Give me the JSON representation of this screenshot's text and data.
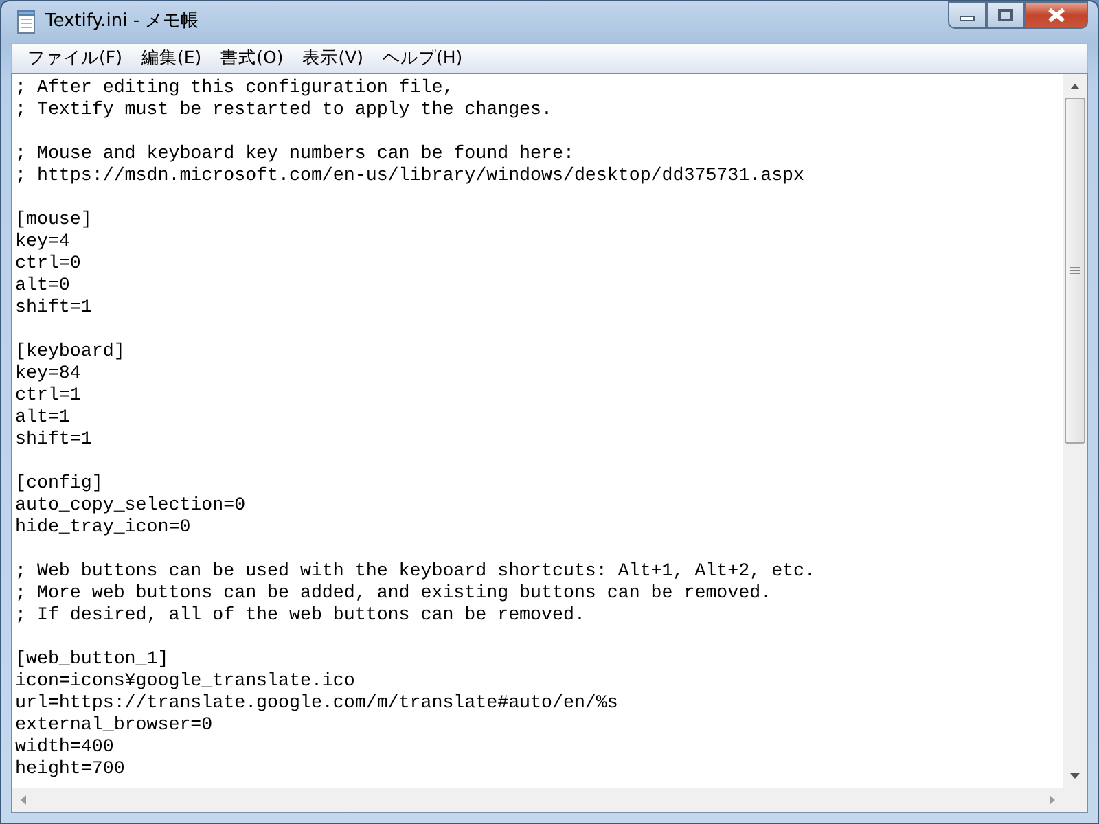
{
  "window": {
    "title": "Textify.ini - メモ帳"
  },
  "menu": [
    {
      "label": "ファイル(F)"
    },
    {
      "label": "編集(E)"
    },
    {
      "label": "書式(O)"
    },
    {
      "label": "表示(V)"
    },
    {
      "label": "ヘルプ(H)"
    }
  ],
  "editor": {
    "blocks": [
      [
        "; After editing this configuration file,",
        "; Textify must be restarted to apply the changes."
      ],
      [
        "; Mouse and keyboard key numbers can be found here:",
        "; https://msdn.microsoft.com/en-us/library/windows/desktop/dd375731.aspx"
      ],
      [
        "[mouse]",
        "key=4",
        "ctrl=0",
        "alt=0",
        "shift=1"
      ],
      [
        "[keyboard]",
        "key=84",
        "ctrl=1",
        "alt=1",
        "shift=1"
      ],
      [
        "[config]",
        "auto_copy_selection=0",
        "hide_tray_icon=0"
      ],
      [
        "; Web buttons can be used with the keyboard shortcuts: Alt+1, Alt+2, etc.",
        "; More web buttons can be added, and existing buttons can be removed.",
        "; If desired, all of the web buttons can be removed."
      ],
      [
        "[web_button_1]",
        "icon=icons¥google_translate.ico",
        "url=https://translate.google.com/m/translate#auto/en/%s",
        "external_browser=0",
        "width=400",
        "height=700"
      ]
    ]
  }
}
